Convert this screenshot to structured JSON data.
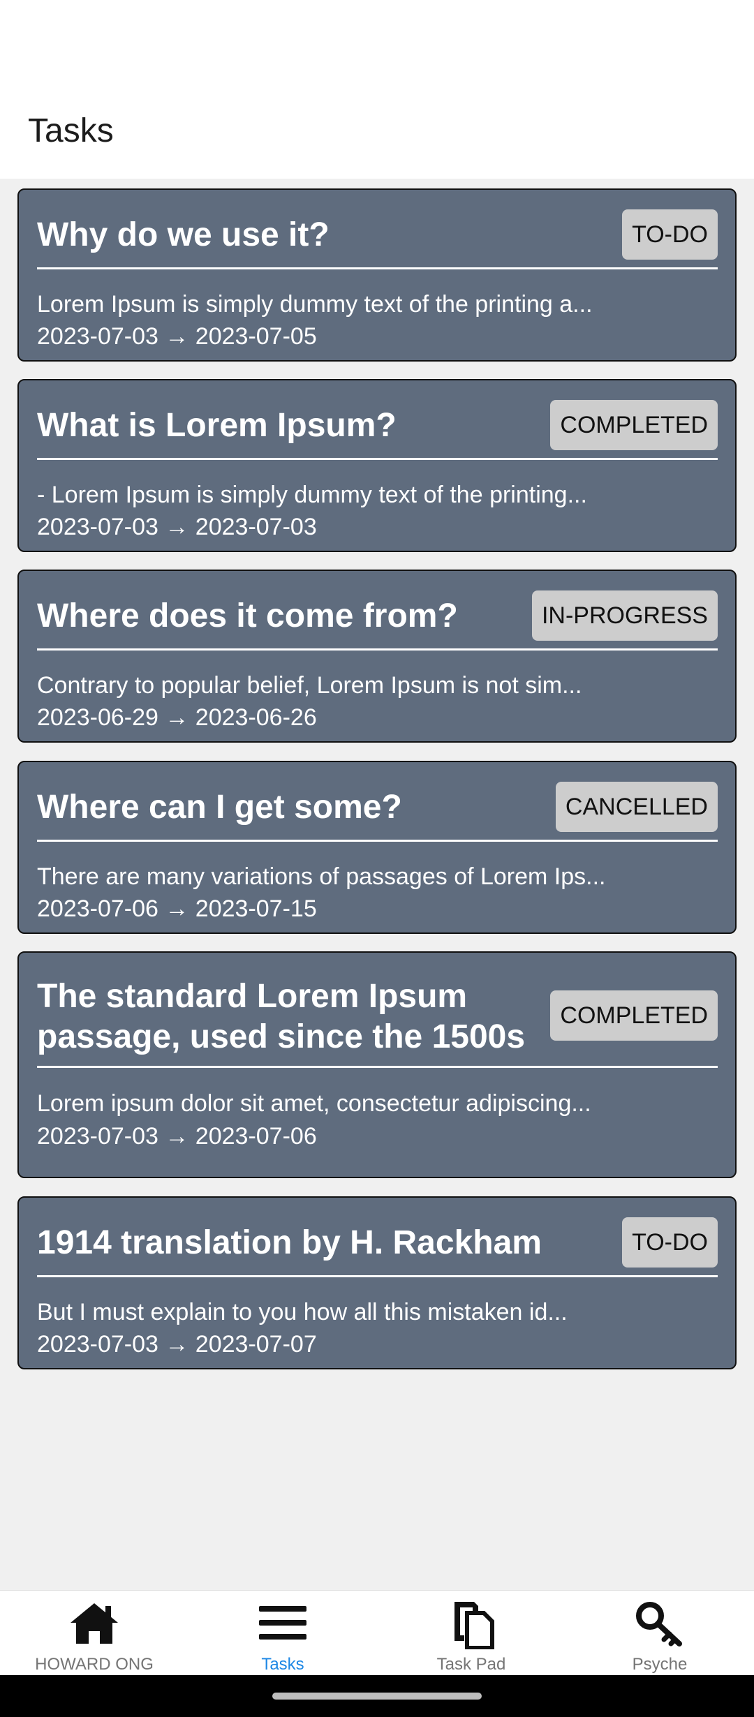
{
  "header": {
    "title": "Tasks"
  },
  "tasks": [
    {
      "title": "Why do we use it?",
      "status": "TO-DO",
      "description": "Lorem Ipsum is simply dummy text of the printing a...",
      "dates": "2023-07-03 → 2023-07-05"
    },
    {
      "title": "What is Lorem Ipsum?",
      "status": "COMPLETED",
      "description": "- Lorem Ipsum is simply dummy text of the printing...",
      "dates": "2023-07-03 → 2023-07-03"
    },
    {
      "title": "Where does it come from?",
      "status": "IN-PROGRESS",
      "description": "Contrary to popular belief, Lorem Ipsum is not sim...",
      "dates": "2023-06-29 → 2023-06-26"
    },
    {
      "title": "Where can I get some?",
      "status": "CANCELLED",
      "description": "There are many variations of passages of Lorem Ips...",
      "dates": "2023-07-06 → 2023-07-15"
    },
    {
      "title": "The standard Lorem Ipsum passage, used since the 1500s",
      "status": "COMPLETED",
      "description": "Lorem ipsum dolor sit amet, consectetur adipiscing...",
      "dates": "2023-07-03 → 2023-07-06"
    },
    {
      "title": "1914 translation by H. Rackham",
      "status": "TO-DO",
      "description": "But I must explain to you how all this mistaken id...",
      "dates": "2023-07-03 → 2023-07-07"
    }
  ],
  "nav": {
    "items": [
      {
        "label": "HOWARD ONG",
        "icon": "home-icon",
        "active": false
      },
      {
        "label": "Tasks",
        "icon": "list-icon",
        "active": true
      },
      {
        "label": "Task Pad",
        "icon": "clipboard-icon",
        "active": false
      },
      {
        "label": "Psyche",
        "icon": "key-icon",
        "active": false
      }
    ]
  },
  "colors": {
    "card_background": "#5f6c7e",
    "badge_background": "#cdcdcd",
    "active_tab": "#1e88e5",
    "inactive_tab": "#757575"
  }
}
